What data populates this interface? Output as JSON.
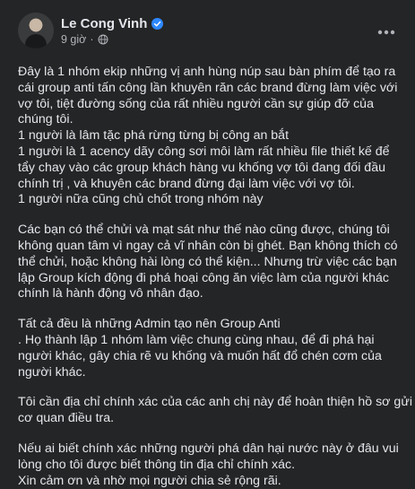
{
  "post": {
    "author": "Le Cong Vinh",
    "time": "9 giờ",
    "separator": "·",
    "paragraphs": [
      [
        "Đây là 1 nhóm ekip những vị anh hùng núp sau bàn phím để tạo ra",
        "cái group anti tấn công lần khuyên răn các brand đừng làm việc với",
        "vợ tôi, tiệt đường sống của rất nhiều người cần sự giúp đỡ của",
        "chúng tôi.",
        "1 người là lâm tặc phá rừng từng bị công an bắt",
        "1 người là 1 acency dãy công sơi môi làm rất nhiều file thiết kế để",
        "tẩy chay vào các group khách hàng vu khống vợ tôi đang đối đầu",
        "chính trị , và khuyên các brand đừng đại làm việc với vợ tôi.",
        "1 người nữa cũng chủ chốt trong nhóm này"
      ],
      [
        "Các bạn có thể chửi và mạt sát như thế nào cũng được, chúng tôi",
        "không quan tâm vì ngay cả vĩ nhân còn bị ghét. Bạn không thích có",
        "thể chửi, hoặc không hài lòng có thể kiện... Nhưng trừ việc các bạn",
        "lập Group kích động đi phá hoại công ăn việc làm của người khác",
        "chính là hành động vô nhân đạo."
      ],
      [
        "Tất cả đều là những Admin tạo nên Group Anti",
        ". Họ thành lập 1 nhóm làm việc chung cùng nhau, để đi phá hại",
        "người khác, gây chia rẽ vu khống và muốn hất đổ chén cơm của",
        "người khác."
      ],
      [
        "Tôi cần địa chỉ chính xác của các anh chị này để hoàn thiện hồ sơ gửi",
        "cơ quan điều tra."
      ],
      [
        "Nếu ai biết chính xác những người phá dân hại nước này ở đâu vui",
        "lòng cho tôi được biết thông tin địa chỉ chính xác.",
        "Xin cảm ơn và nhờ mọi người chia sẻ rộng rãi."
      ]
    ]
  },
  "colors": {
    "background": "#242526",
    "text_primary": "#e4e6eb",
    "text_secondary": "#b0b3b8",
    "verified_blue": "#2d88ff"
  },
  "icons": {
    "verified": "verified-badge-icon",
    "audience": "globe-icon",
    "more": "more-options-icon"
  }
}
